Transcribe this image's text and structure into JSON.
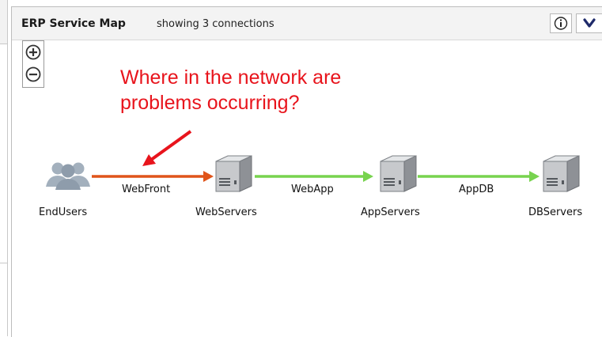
{
  "panel": {
    "title": "ERP Service Map",
    "subtitle": "showing 3 connections"
  },
  "annotation": {
    "text": "Where in the network are\nproblems occurring?",
    "color": "#e8141c"
  },
  "nodes": [
    {
      "label": "EndUsers",
      "icon": "users-icon"
    },
    {
      "label": "WebServers",
      "icon": "server-icon"
    },
    {
      "label": "AppServers",
      "icon": "server-icon"
    },
    {
      "label": "DBServers",
      "icon": "server-icon"
    }
  ],
  "connections": [
    {
      "label": "WebFront",
      "status_color": "#e0541a"
    },
    {
      "label": "WebApp",
      "status_color": "#78d34f"
    },
    {
      "label": "AppDB",
      "status_color": "#78d34f"
    }
  ],
  "icons": {
    "zoom_in": "zoom-in-icon",
    "zoom_out": "zoom-out-icon",
    "info": "info-icon",
    "menu": "chevron-down-icon"
  }
}
